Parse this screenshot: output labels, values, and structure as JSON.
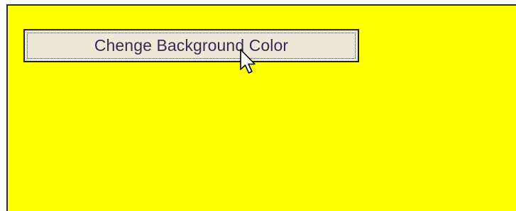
{
  "page": {
    "background_color": "#ffff00",
    "border_color": "#2b2b2b"
  },
  "button": {
    "label": "Chenge Background Color",
    "face_color": "#ece9d8",
    "text_color": "#3a2a52"
  },
  "cursor": {
    "icon": "arrow-pointer-icon"
  }
}
